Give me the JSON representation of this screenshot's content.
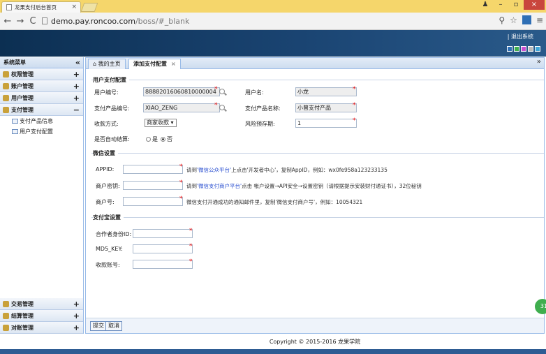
{
  "browser": {
    "tab_title": "龙果支付后台首页",
    "tab_close": "×",
    "url_domain": "demo.pay.roncoo.com",
    "url_path": "/boss/#_blank"
  },
  "header": {
    "logout": "| 退出系统",
    "theme_colors": [
      "#2f6fb5",
      "#3fae4e",
      "#c94fd0",
      "#b9b9b9",
      "#3ea6d8"
    ]
  },
  "sidebar": {
    "title": "系统菜单",
    "collapse": "«",
    "top_items": [
      {
        "label": "权限管理",
        "toggle": "+"
      },
      {
        "label": "账户管理",
        "toggle": "+"
      },
      {
        "label": "用户管理",
        "toggle": "+"
      },
      {
        "label": "支付管理",
        "toggle": "−"
      }
    ],
    "sub_items": [
      {
        "label": "支付产品信息"
      },
      {
        "label": "用户支付配置"
      }
    ],
    "bottom_items": [
      {
        "label": "交易管理",
        "toggle": "+"
      },
      {
        "label": "结算管理",
        "toggle": "+"
      },
      {
        "label": "对账管理",
        "toggle": "+"
      }
    ]
  },
  "tabs": {
    "home": "⌂ 我的主页",
    "active": "添加支付配置",
    "close": "×",
    "more": "»"
  },
  "user_section": {
    "legend": "用户支付配置",
    "user_no_label": "用户编号:",
    "user_no_value": "88882016060810000004",
    "user_name_label": "用户名:",
    "user_name_value": "小龙",
    "product_no_label": "支付产品编号:",
    "product_no_value": "XIAO_ZENG",
    "product_name_label": "支付产品名称:",
    "product_name_value": "小曾支付产品",
    "collect_label": "收款方式:",
    "collect_value": "商家收款 ▾",
    "risk_label": "风险预存期:",
    "risk_value": "1",
    "auto_settle_label": "是否自动结算:",
    "opt_yes": "是",
    "opt_no": "否"
  },
  "wechat_section": {
    "legend": "微信设置",
    "appid_label": "APPID:",
    "appid_hint_pre": "请到",
    "appid_hint_link": "'微信公众平台'",
    "appid_hint_post": "上点击'开发者中心'，复制AppID，例如：wx0fe958a123233135",
    "key_label": "商户密钥:",
    "key_hint_pre": "请到",
    "key_hint_link": "'微信支付商户平台'",
    "key_hint_post": "点击 帐户设置→API安全→设置密钥（请根据提示安装财付通证书），32位秘钥",
    "mch_label": "商户号:",
    "mch_hint": "微信支付开通成功的通知邮件里，复制'微信支付商户号'，例如：10054321"
  },
  "alipay_section": {
    "legend": "支付宝设置",
    "partner_label": "合作者身份ID:",
    "md5_label": "MD5_KEY:",
    "account_label": "收款账号:"
  },
  "buttons": {
    "submit": "提交",
    "cancel": "取消"
  },
  "footer": {
    "copyright": "Copyright © 2015-2016 龙果学院"
  },
  "badge": "31",
  "required_mark": "*"
}
